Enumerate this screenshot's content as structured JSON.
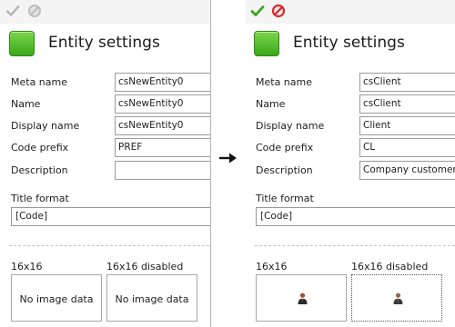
{
  "before": {
    "title": "Entity settings",
    "fields": [
      {
        "label": "Meta name",
        "value": "csNewEntity0"
      },
      {
        "label": "Name",
        "value": "csNewEntity0"
      },
      {
        "label": "Display name",
        "value": "csNewEntity0"
      },
      {
        "label": "Code prefix",
        "value": "PREF"
      },
      {
        "label": "Description",
        "value": ""
      }
    ],
    "title_format": {
      "label": "Title format",
      "value": "[Code]"
    },
    "images": {
      "label_16": "16x16",
      "label_16_disabled": "16x16 disabled",
      "placeholder_16": "No image data",
      "placeholder_16_disabled": "No image data"
    },
    "toolbar": {
      "ok_icon": "check-icon",
      "cancel_icon": "cancel-icon",
      "state": "disabled"
    }
  },
  "after": {
    "title": "Entity settings",
    "fields": [
      {
        "label": "Meta name",
        "value": "csClient"
      },
      {
        "label": "Name",
        "value": "csClient"
      },
      {
        "label": "Display name",
        "value": "Client"
      },
      {
        "label": "Code prefix",
        "value": "CL"
      },
      {
        "label": "Description",
        "value": "Company customers"
      }
    ],
    "title_format": {
      "label": "Title format",
      "value": "[Code]"
    },
    "images": {
      "label_16": "16x16",
      "label_16_disabled": "16x16 disabled",
      "icon_16": "user-icon",
      "icon_16_disabled": "user-icon"
    },
    "toolbar": {
      "ok_icon": "check-icon",
      "cancel_icon": "cancel-icon",
      "state": "enabled"
    }
  },
  "arrow_icon": "arrow-right-icon",
  "colors": {
    "entity_green": "#4cbf2a",
    "ok_green": "#3aa51d",
    "cancel_red": "#d62b2b",
    "disabled_gray": "#b8b8b8"
  }
}
